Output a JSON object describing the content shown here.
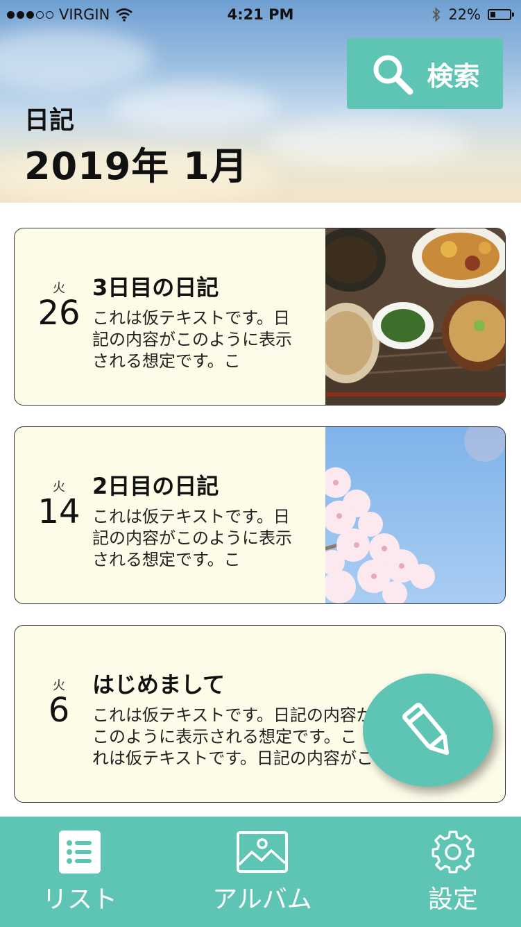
{
  "status_bar": {
    "carrier": "VIRGIN",
    "time": "4:21 PM",
    "battery": "22%",
    "battery_level": 0.22
  },
  "header": {
    "search_label": "検索",
    "page_label": "日記",
    "month_title": "2019年 1月"
  },
  "entries": [
    {
      "dow": "火",
      "day": "26",
      "title": "3日目の日記",
      "excerpt": "これは仮テキストです。日記の内容がこのように表示される想定です。こ",
      "photo": "food-photo"
    },
    {
      "dow": "火",
      "day": "14",
      "title": "2日目の日記",
      "excerpt": "これは仮テキストです。日記の内容がこのように表示される想定です。こ",
      "photo": "cherry-blossom-photo"
    },
    {
      "dow": "火",
      "day": "6",
      "title": "はじめまして",
      "excerpt": "これは仮テキストです。日記の内容がこのように表示される想定です。これは仮テキストです。日記の内容がこのように表示"
    }
  ],
  "fab_icon": "pencil-icon",
  "tabs": [
    {
      "label": "リスト",
      "icon": "list-icon"
    },
    {
      "label": "アルバム",
      "icon": "image-icon"
    },
    {
      "label": "設定",
      "icon": "gear-icon"
    }
  ],
  "colors": {
    "accent": "#5ec5b4",
    "card_background": "#fdfce8"
  }
}
